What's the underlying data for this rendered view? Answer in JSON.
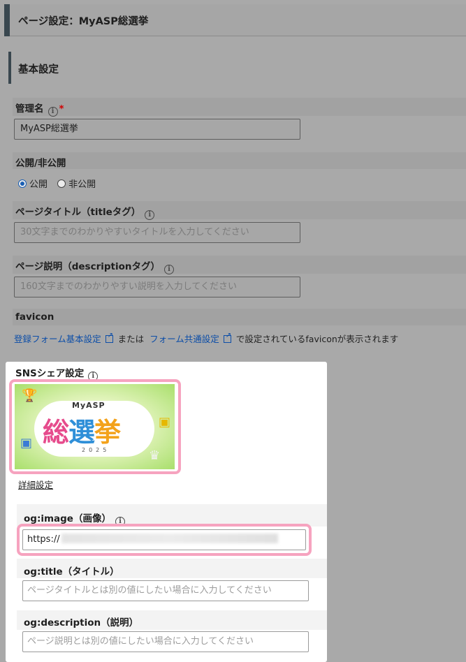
{
  "header": {
    "title": "ページ設定：MyASP総選挙"
  },
  "basic": {
    "section_title": "基本設定",
    "admin_name": {
      "label": "管理名",
      "required_mark": "*",
      "value": "MyASP総選挙"
    },
    "visibility": {
      "label": "公開/非公開",
      "options": [
        "公開",
        "非公開"
      ],
      "selected": "公開"
    },
    "page_title": {
      "label": "ページタイトル（titleタグ）",
      "placeholder": "30文字までのわかりやすいタイトルを入力してください"
    },
    "page_desc": {
      "label": "ページ説明（descriptionタグ）",
      "placeholder": "160文字までのわかりやすい説明を入力してください"
    },
    "favicon": {
      "label": "favicon",
      "link1": "登録フォーム基本設定",
      "middle": "または",
      "link2": "フォーム共通設定",
      "suffix": "で設定されているfaviconが表示されます"
    }
  },
  "sns": {
    "title": "SNSシェア設定",
    "banner": {
      "small": "MyASP",
      "big": [
        "総",
        "選",
        "挙"
      ],
      "year": "2025"
    },
    "detail_link": "詳細設定",
    "og_image": {
      "label": "og:image（画像）",
      "value": "https://"
    },
    "og_title": {
      "label": "og:title（タイトル）",
      "placeholder": "ページタイトルとは別の値にしたい場合に入力してください"
    },
    "og_description": {
      "label": "og:description（説明）",
      "placeholder": "ページ説明とは別の値にしたい場合に入力してください"
    }
  },
  "colors": {
    "accent_bar": "#39474f",
    "link": "#0d4ea8",
    "required": "#d10000",
    "highlight": "#f6a3bf",
    "radio_on": "#1a5fb4"
  }
}
